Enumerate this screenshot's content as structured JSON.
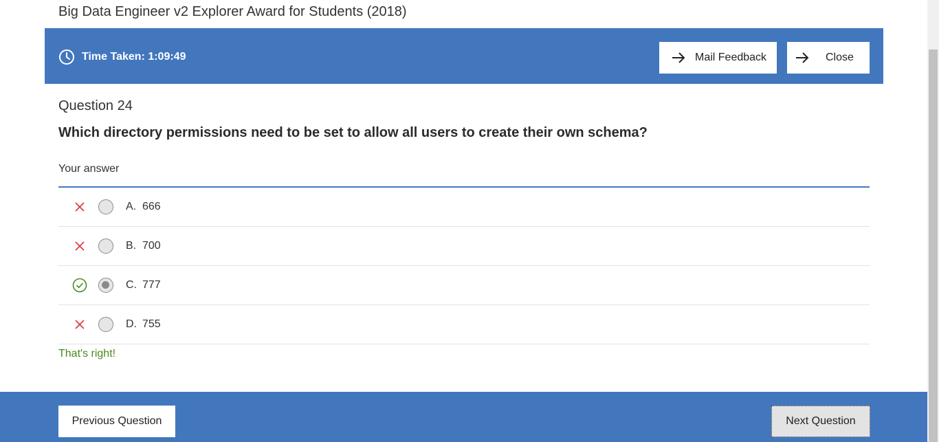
{
  "page": {
    "title": "Big Data Engineer v2 Explorer Award for Students (2018)"
  },
  "header": {
    "timer_label": "Time Taken: 1:09:49",
    "mail_feedback_label": "Mail Feedback",
    "close_label": "Close",
    "accent_color": "#4277be"
  },
  "question": {
    "number_label": "Question 24",
    "text": "Which directory permissions need to be set to allow all users to create their own schema?",
    "answer_label": "Your answer",
    "options": [
      {
        "letter": "A.",
        "value": "666",
        "status": "incorrect",
        "selected": false
      },
      {
        "letter": "B.",
        "value": "700",
        "status": "incorrect",
        "selected": false
      },
      {
        "letter": "C.",
        "value": "777",
        "status": "correct",
        "selected": true
      },
      {
        "letter": "D.",
        "value": "755",
        "status": "incorrect",
        "selected": false
      }
    ],
    "feedback": "That's right!",
    "feedback_color": "#4a8a1e"
  },
  "footer": {
    "previous_label": "Previous Question",
    "next_label": "Next Question"
  },
  "icons": {
    "timer": "clock-icon",
    "mail": "arrow-right-icon",
    "close": "arrow-right-icon",
    "incorrect": "cross-icon",
    "correct": "check-circle-icon"
  }
}
